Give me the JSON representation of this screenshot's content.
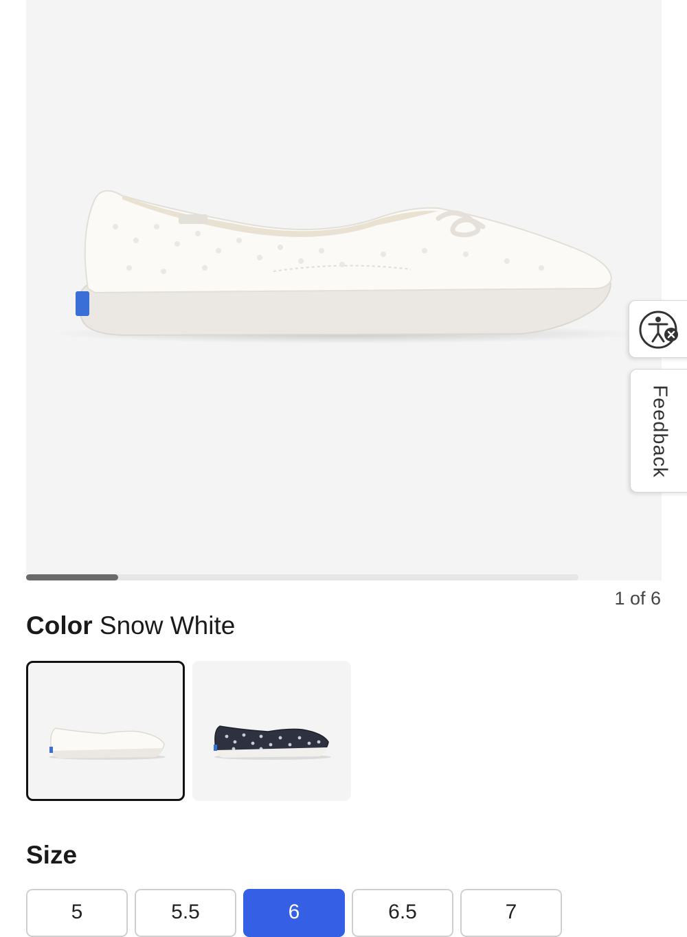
{
  "gallery": {
    "counter": "1 of 6",
    "current_index": 1,
    "total": 6,
    "main_image_icon": "white-eyelet-slip-on-shoe-image"
  },
  "color": {
    "label": "Color",
    "value": "Snow White",
    "swatches": [
      {
        "name": "Snow White",
        "icon": "white-shoe-thumbnail",
        "selected": true
      },
      {
        "name": "navy-pattern",
        "icon": "navy-print-shoe-thumbnail",
        "selected": false
      }
    ]
  },
  "size": {
    "title": "Size",
    "options": [
      "5",
      "5.5",
      "6",
      "6.5",
      "7"
    ],
    "selected_index": 2
  },
  "accessibility": {
    "icon": "accessibility-person-icon"
  },
  "feedback": {
    "label": "Feedback"
  },
  "colors": {
    "accent": "#3560e6",
    "hero_background": "#f4f4f4",
    "progress_fill": "#6a6a6a"
  }
}
